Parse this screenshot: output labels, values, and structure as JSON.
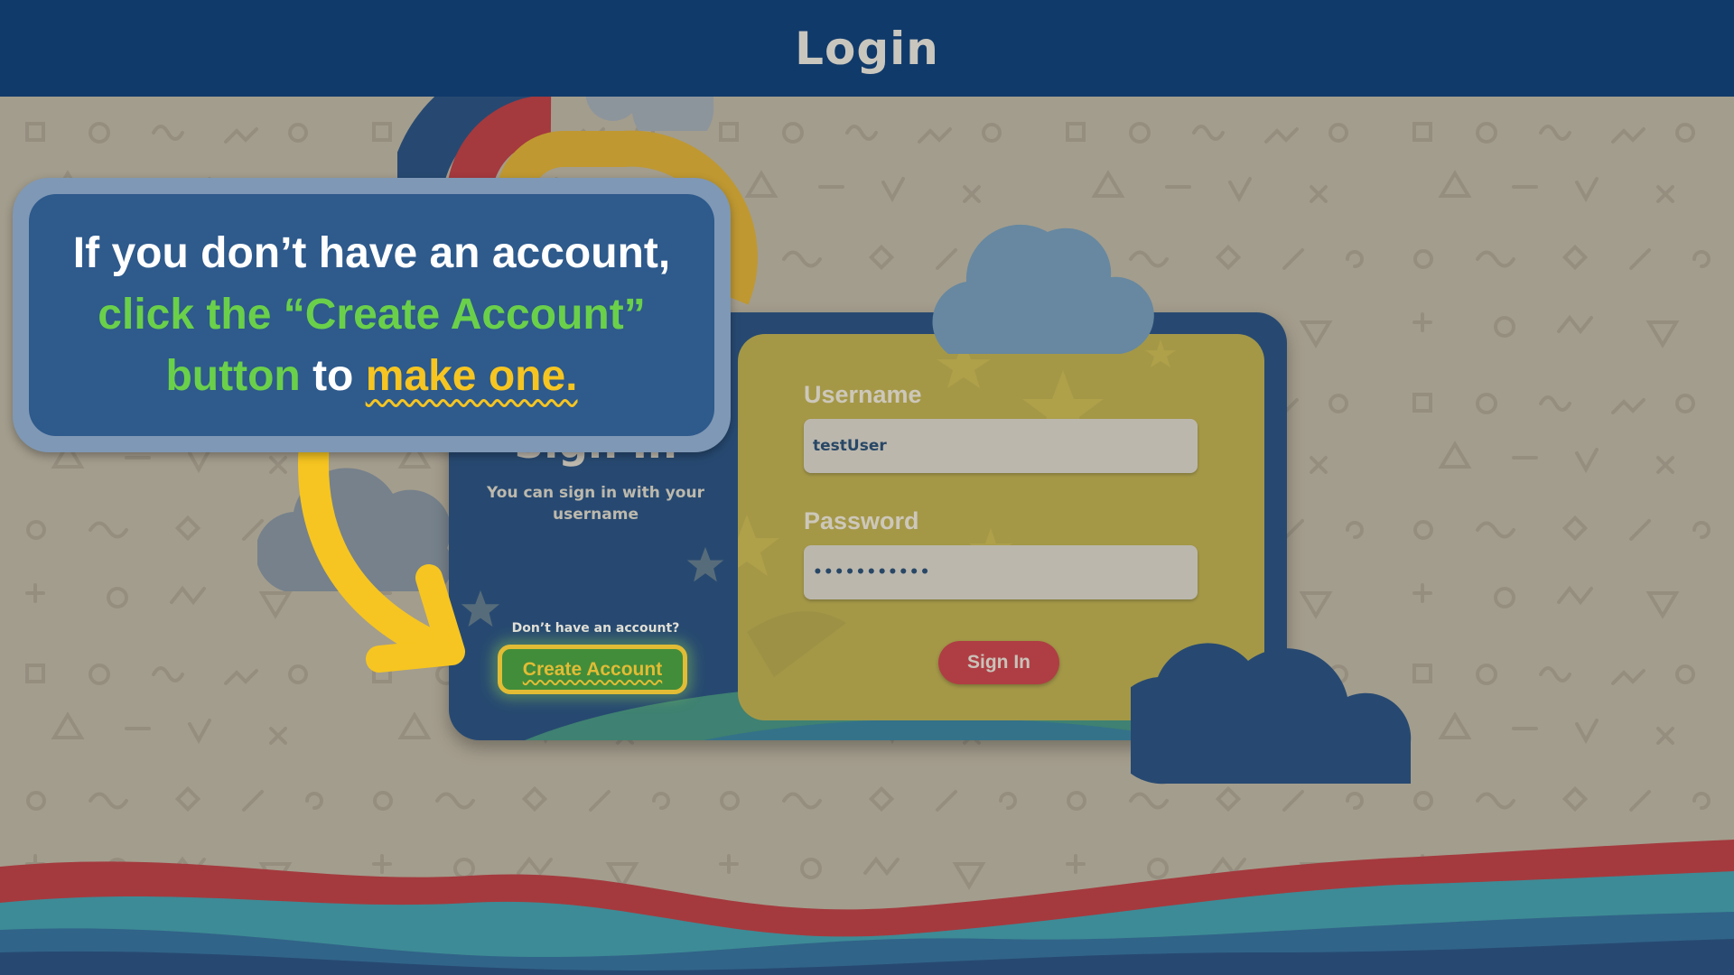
{
  "header": {
    "title": "Login"
  },
  "login_card": {
    "heading": "Sign In",
    "subtext": "You can sign in with your username",
    "no_account_prompt": "Don’t have an account?",
    "create_account_label": "Create Account",
    "username_label": "Username",
    "username_value": "testUser",
    "password_label": "Password",
    "password_value": "•••••••••••",
    "sign_in_label": "Sign In"
  },
  "callout": {
    "line1": "If you don’t have an account,",
    "line2": "click the “Create Account”",
    "line3_green": "button",
    "line3_mid": " to ",
    "line3_yellow": "make one."
  },
  "colors": {
    "header_bg": "#103a6a",
    "background": "#a7a08f",
    "card_bg": "#0f3a6d",
    "form_panel": "#a89a3a",
    "create_button": "#2f8d2a",
    "accent_yellow": "#f3c623",
    "sign_in_button": "#b52c36",
    "callout_bg": "#2e5a8c",
    "highlight_green": "#6ad04a"
  },
  "icons": [
    "cloud-icon",
    "rainbow-icon",
    "star-icon",
    "pointer-arrow-icon"
  ]
}
